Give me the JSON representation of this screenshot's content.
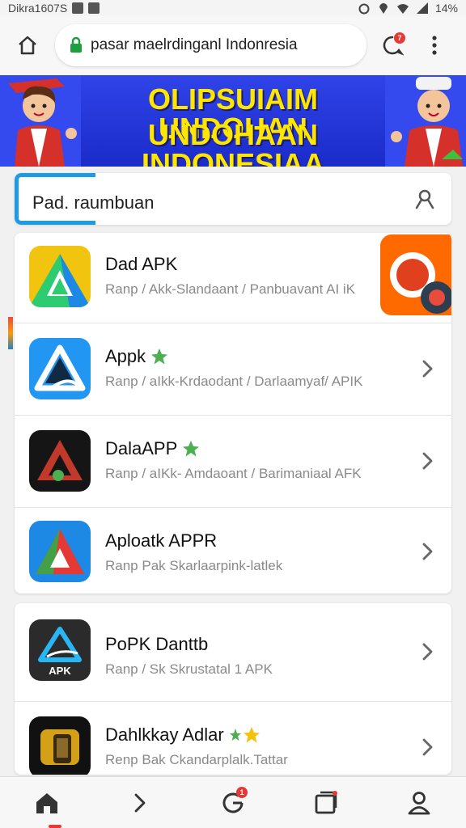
{
  "status_bar": {
    "left_text": "Dikra1607S",
    "right_text": "14%"
  },
  "browser": {
    "url": "pasar maelrdinganl Indonresia",
    "notification_count": "7"
  },
  "banner": {
    "line1": "OLIPSUIAIM UNDOHAN",
    "line2": "UNDOHAAN INDONESIAA"
  },
  "search": {
    "text": "Pad. raumbuan"
  },
  "apps": [
    {
      "name": "Dad APK",
      "subtitle": "Ranp / Akk-Slandaant / Panbuavant AI iK",
      "star": false,
      "icon_theme": "green-yellow"
    },
    {
      "name": "Appk",
      "subtitle": "Ranp / aIkk-Krdaodant / Darlaamyaf/ APIK",
      "star": true,
      "icon_theme": "blue"
    },
    {
      "name": "DalaAPP",
      "subtitle": "Ranp / aIKk- Amdaoant / Barimaniaal AFK",
      "star": true,
      "icon_theme": "black-red"
    },
    {
      "name": "Aploatk APPR",
      "subtitle": "Ranp Pak Skarlaarpink-latlek",
      "star": false,
      "icon_theme": "blue-red-green"
    },
    {
      "name": "PoPK Danttb",
      "subtitle": "Ranp / Sk Skrustatal 1 APK",
      "star": false,
      "icon_theme": "dark-apk",
      "icon_label": "APK"
    },
    {
      "name": "Dahlkkay Adlar",
      "subtitle": "Renp Bak Ckandarplalk.Tattar",
      "star": true,
      "icon_theme": "black-gold"
    }
  ],
  "nav": {
    "badge_count": "1"
  },
  "colors": {
    "banner_bg": "#2f43e8",
    "banner_text": "#ffe600",
    "accent_red": "#e53935",
    "search_accent": "#1e9be5"
  }
}
